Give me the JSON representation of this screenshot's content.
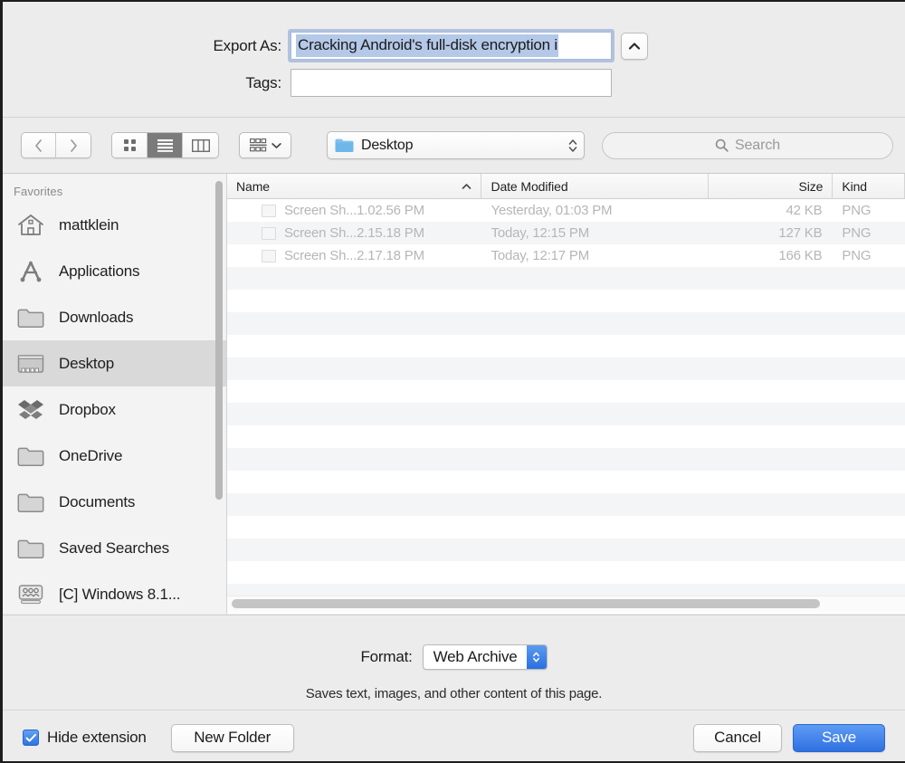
{
  "dialog": {
    "export_as_label": "Export As:",
    "export_as_value": "Cracking Android's full-disk encryption i",
    "tags_label": "Tags:",
    "tags_value": "",
    "collapse_icon": "chevron-up-icon"
  },
  "toolbar": {
    "back_icon": "chevron-left-icon",
    "forward_icon": "chevron-right-icon",
    "view_icon_grid": "icon-view-icon",
    "view_list": "list-view-icon",
    "view_column": "column-view-icon",
    "arrange_icon": "arrange-by-icon",
    "arrange_chevron": "chevron-down-icon",
    "location_label": "Desktop",
    "location_icon": "folder-icon",
    "location_stepper_icon": "updown-stepper-icon",
    "search_placeholder": "Search",
    "search_icon": "search-icon"
  },
  "sidebar": {
    "header": "Favorites",
    "items": [
      {
        "label": "mattklein",
        "icon": "home-icon",
        "selected": false
      },
      {
        "label": "Applications",
        "icon": "applications-icon",
        "selected": false
      },
      {
        "label": "Downloads",
        "icon": "folder-icon",
        "selected": false
      },
      {
        "label": "Desktop",
        "icon": "desktop-icon",
        "selected": true
      },
      {
        "label": "Dropbox",
        "icon": "dropbox-icon",
        "selected": false
      },
      {
        "label": "OneDrive",
        "icon": "folder-icon",
        "selected": false
      },
      {
        "label": "Documents",
        "icon": "folder-icon",
        "selected": false
      },
      {
        "label": "Saved Searches",
        "icon": "folder-icon",
        "selected": false
      },
      {
        "label": "[C] Windows 8.1...",
        "icon": "network-drive-icon",
        "selected": false
      }
    ]
  },
  "filelist": {
    "columns": [
      "Name",
      "Date Modified",
      "Size",
      "Kind"
    ],
    "sort_indicator": "chevron-up-icon",
    "rows": [
      {
        "name": "Screen Sh...1.02.56 PM",
        "date": "Yesterday, 01:03 PM",
        "size": "42 KB",
        "kind": "PNG"
      },
      {
        "name": "Screen Sh...2.15.18 PM",
        "date": "Today, 12:15 PM",
        "size": "127 KB",
        "kind": "PNG"
      },
      {
        "name": "Screen Sh...2.17.18 PM",
        "date": "Today, 12:17 PM",
        "size": "166 KB",
        "kind": "PNG"
      }
    ]
  },
  "format": {
    "label": "Format:",
    "value": "Web Archive",
    "description": "Saves text, images, and other content of this page."
  },
  "bottom": {
    "hide_extension_label": "Hide extension",
    "hide_extension_checked": true,
    "new_folder_label": "New Folder",
    "cancel_label": "Cancel",
    "save_label": "Save"
  },
  "colors": {
    "accent": "#2f70e2",
    "selection": "#b4c8e8",
    "window_bg": "#ececec"
  }
}
